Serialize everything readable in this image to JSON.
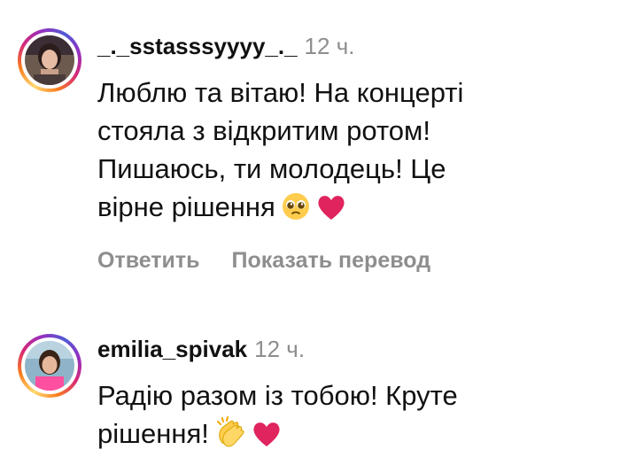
{
  "comments": [
    {
      "username": "_._sstasssyyyy_._",
      "time": "12 ч.",
      "lines": [
        "Люблю та вітаю! На концерті",
        "стояла з відкритим ротом!",
        "Пишаюсь, ти молодець! Це",
        "вірне рішення"
      ],
      "emojis": [
        "pleading-face-emoji",
        "red-heart-emoji"
      ],
      "actions": {
        "reply": "Ответить",
        "translate": "Показать перевод"
      }
    },
    {
      "username": "emilia_spivak",
      "time": "12 ч.",
      "lines": [
        "Радію разом із тобою! Круте",
        "рішення!"
      ],
      "emojis": [
        "clapping-hands-emoji",
        "red-heart-emoji"
      ]
    }
  ],
  "colors": {
    "text": "#111111",
    "secondary": "#8e8e8e",
    "heart": "#e0245e"
  }
}
